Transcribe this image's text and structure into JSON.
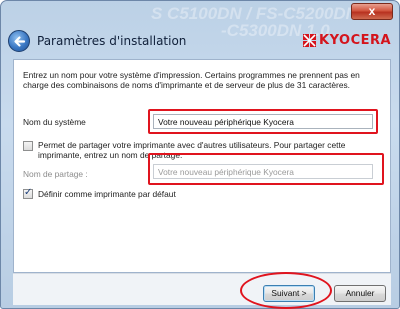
{
  "window": {
    "watermark_line1": "S C5100DN / FS-C5200DN / FS-C",
    "watermark_line2": "-C5300DN 1.0",
    "close_label": "x",
    "title": "Paramètres d'installation",
    "logo_text": "KYOCERA"
  },
  "intro": {
    "text": "Entrez un nom pour votre système d'impression. Certains programmes ne prennent pas en charge des combinaisons de noms d'imprimante et de serveur de plus de 31 caractères."
  },
  "system_name": {
    "label": "Nom du système",
    "value": "Votre nouveau périphérique Kyocera"
  },
  "share": {
    "checkbox_label": "Permet de partager votre imprimante avec d'autres utilisateurs. Pour partager cette imprimante, entrez un nom de partage.",
    "checked": false,
    "label": "Nom de partage :",
    "value": "Votre nouveau périphérique Kyocera"
  },
  "default_printer": {
    "checkbox_label": "Définir comme imprimante par défaut",
    "checked": true
  },
  "footer": {
    "next_label": "Suivant >",
    "cancel_label": "Annuler"
  },
  "colors": {
    "highlight": "#e0141e",
    "logo": "#d4141c"
  },
  "icons": {
    "back": "back-arrow-icon",
    "logo_mark": "kyocera-logo-icon"
  }
}
